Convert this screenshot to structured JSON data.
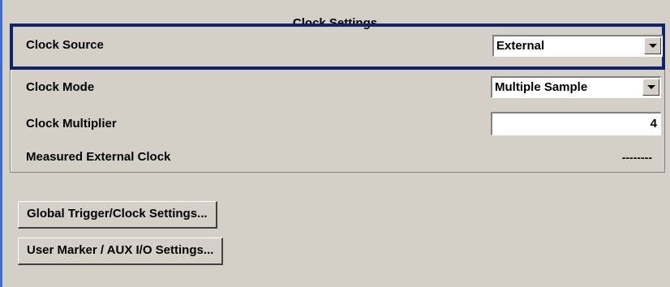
{
  "group": {
    "title": "Clock Settings"
  },
  "rows": {
    "clock_source": {
      "label": "Clock Source",
      "value": "External"
    },
    "clock_mode": {
      "label": "Clock Mode",
      "value": "Multiple Sample"
    },
    "clock_multiplier": {
      "label": "Clock Multiplier",
      "value": "4"
    },
    "measured_external_clock": {
      "label": "Measured External Clock",
      "value": "--------"
    }
  },
  "buttons": {
    "global_trigger": "Global Trigger/Clock Settings...",
    "user_marker": "User Marker / AUX I/O Settings..."
  },
  "colors": {
    "background": "#d4d0c8",
    "selection_border": "#10246a",
    "left_accent": "#3c6fd1"
  },
  "icons": {
    "dropdown": "chevron-down-icon"
  }
}
